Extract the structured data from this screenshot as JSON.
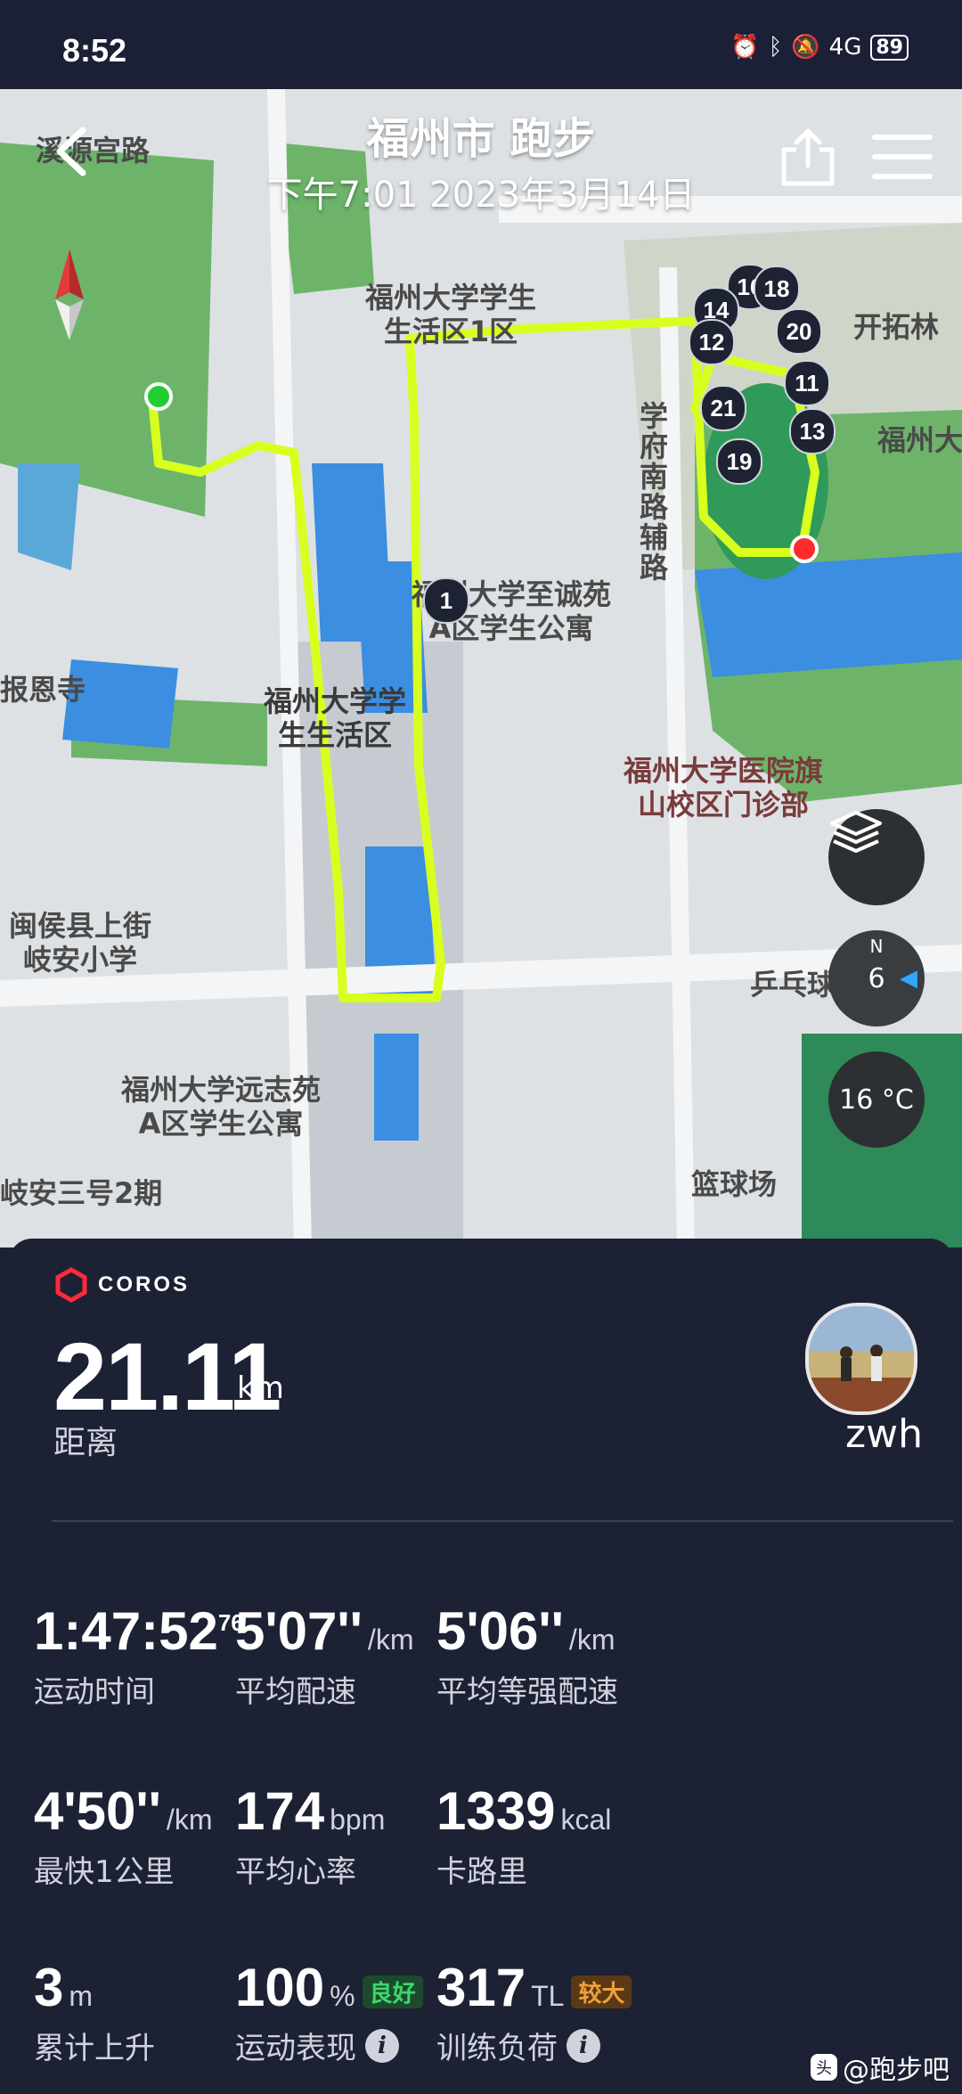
{
  "status_bar": {
    "time": "8:52",
    "network_label": "4G",
    "battery": "89"
  },
  "header": {
    "title": "福州市 跑步",
    "subtitle": "下午7:01 2023年3月14日"
  },
  "map": {
    "labels": {
      "road_xiyuan": "溪源宫路",
      "fzu_life1": "福州大学学生\n生活区1区",
      "kaituolin": "开拓林",
      "fuzhou": "福州大",
      "xuefu_road": "学\n府\n南\n路\n辅\n路",
      "fzu_zhicheng": "福州大学至诚苑\nA区学生公寓",
      "enshi": "报恩寺",
      "fzu_life": "福州大学学\n生生活区",
      "hospital": "福州大学医院旗\n山校区门诊部",
      "school": "闽侯县上街\n岐安小学",
      "pingpong": "乒乓球馆",
      "fzu_yuanzhi": "福州大学远志苑\nA区学生公寓",
      "qian3": "岐安三号2期",
      "basketball": "篮球场"
    },
    "lap_markers": [
      "16",
      "18",
      "14",
      "12",
      "20",
      "11",
      "21",
      "13",
      "19",
      "1"
    ],
    "temperature": "16 °C",
    "compass_value": "6",
    "compass_n": "N",
    "colors": {
      "route": "#d9ff1f",
      "start": "#22cc33",
      "end": "#ff2a2a"
    }
  },
  "summary": {
    "brand": "COROS",
    "distance": "21.11",
    "distance_unit": "km",
    "distance_label": "距离",
    "username": "zwh"
  },
  "stats": [
    {
      "value": "1:47:52",
      "sup": "76",
      "unit": "",
      "label": "运动时间"
    },
    {
      "value": "5'07''",
      "unit": "/km",
      "label": "平均配速"
    },
    {
      "value": "5'06''",
      "unit": "/km",
      "label": "平均等强配速"
    },
    {
      "value": "4'50''",
      "unit": "/km",
      "label": "最快1公里"
    },
    {
      "value": "174",
      "unit": "bpm",
      "label": "平均心率"
    },
    {
      "value": "1339",
      "unit": "kcal",
      "label": "卡路里"
    },
    {
      "value": "3",
      "unit": "m",
      "label": "累计上升"
    },
    {
      "value": "100",
      "unit": "%",
      "badge": "良好",
      "label": "运动表现"
    },
    {
      "value": "317",
      "unit": "TL",
      "badge": "较大",
      "label": "训练负荷"
    }
  ],
  "watermark": "@跑步吧",
  "watermark_icon": "头"
}
